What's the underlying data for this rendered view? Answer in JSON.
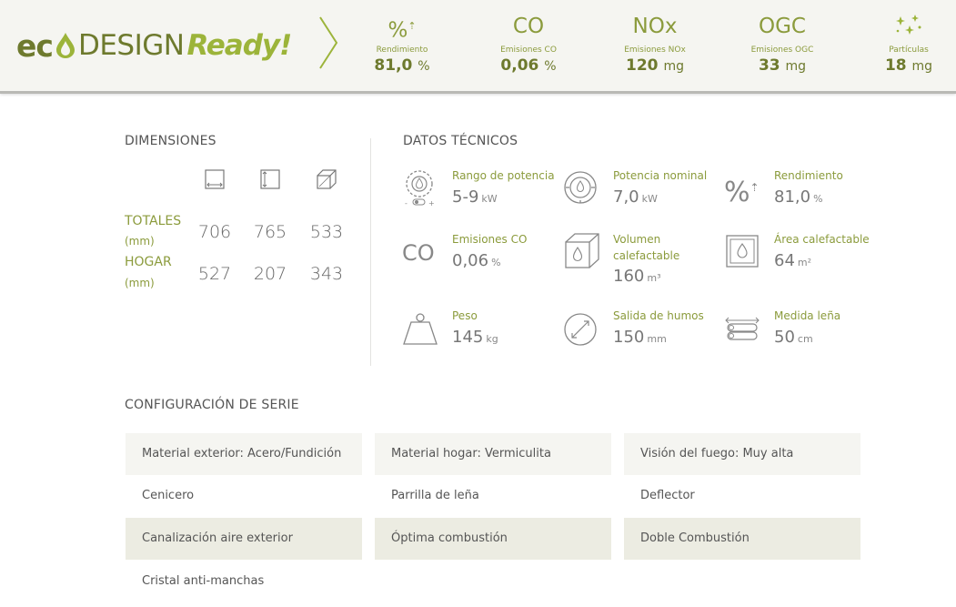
{
  "banner": {
    "logo": {
      "eco": "ec",
      "design": "DESIGN",
      "ready": "Ready!"
    },
    "kpis": [
      {
        "symbol": "%",
        "label": "Rendimiento",
        "value": "81,0",
        "unit": "%"
      },
      {
        "symbol": "CO",
        "label": "Emisiones CO",
        "value": "0,06",
        "unit": "%"
      },
      {
        "symbol": "NOx",
        "label": "Emisiones NOx",
        "value": "120",
        "unit": "mg"
      },
      {
        "symbol": "OGC",
        "label": "Emisiones OGC",
        "value": "33",
        "unit": "mg"
      },
      {
        "symbol": "",
        "label": "Partículas",
        "value": "18",
        "unit": "mg"
      }
    ]
  },
  "dimensions": {
    "title": "DIMENSIONES",
    "icons": [
      "width-icon",
      "height-icon",
      "depth-icon"
    ],
    "rows": [
      {
        "label": "TOTALES",
        "unit": "(mm)",
        "values": [
          "706",
          "765",
          "533"
        ]
      },
      {
        "label": "HOGAR",
        "unit": "(mm)",
        "values": [
          "527",
          "207",
          "343"
        ]
      }
    ]
  },
  "tech": {
    "title": "DATOS TÉCNICOS",
    "items": [
      {
        "icon": "power-range-icon",
        "label": "Rango de potencia",
        "value": "5-9",
        "unit": "kW"
      },
      {
        "icon": "nominal-power-icon",
        "label": "Potencia nominal",
        "value": "7,0",
        "unit": "kW"
      },
      {
        "icon": "efficiency-icon",
        "label": "Rendimiento",
        "value": "81,0",
        "unit": "%"
      },
      {
        "icon": "co-emissions-icon",
        "label": "Emisiones CO",
        "value": "0,06",
        "unit": "%"
      },
      {
        "icon": "heated-volume-icon",
        "label": "Volumen calefactable",
        "value": "160",
        "unit": "m³"
      },
      {
        "icon": "heated-area-icon",
        "label": "Área calefactable",
        "value": "64",
        "unit": "m²"
      },
      {
        "icon": "weight-icon",
        "label": "Peso",
        "value": "145",
        "unit": "kg"
      },
      {
        "icon": "flue-outlet-icon",
        "label": "Salida de humos",
        "value": "150",
        "unit": "mm"
      },
      {
        "icon": "log-size-icon",
        "label": "Medida leña",
        "value": "50",
        "unit": "cm"
      }
    ]
  },
  "config": {
    "title": "CONFIGURACIÓN DE SERIE",
    "items": [
      "Material exterior: Acero/Fundición",
      "Material hogar: Vermiculita",
      "Visión del fuego: Muy alta",
      "Cenicero",
      "Parrilla de leña",
      "Deflector",
      "Canalización aire exterior",
      "Óptima combustión",
      "Doble Combustión",
      "Cristal anti-manchas"
    ]
  },
  "colors": {
    "accent": "#8b9b3c",
    "dark_accent": "#6e7a2e",
    "bright_accent": "#9cb43a",
    "banner_bg": "#f5f5f1",
    "row_dark": "#ecece2"
  }
}
